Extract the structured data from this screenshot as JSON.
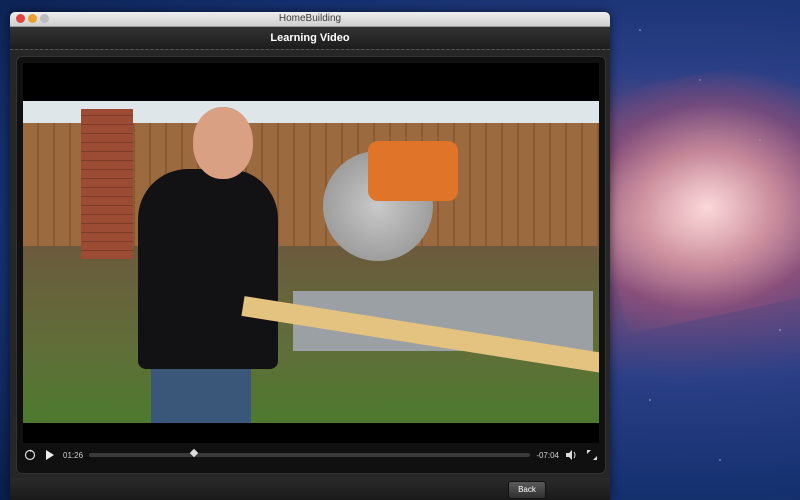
{
  "window": {
    "title": "HomeBuilding"
  },
  "header": {
    "title": "Learning Video"
  },
  "player": {
    "elapsed": "01:26",
    "remaining": "-07:04",
    "progress": 0.23,
    "icons": {
      "replay": "replay-30-icon",
      "play": "play-icon",
      "volume": "volume-icon",
      "fullscreen": "fullscreen-icon"
    }
  },
  "footer": {
    "back_label": "Back"
  },
  "colors": {
    "accent_orange": "#e0752a",
    "window_bg": "#262626"
  }
}
